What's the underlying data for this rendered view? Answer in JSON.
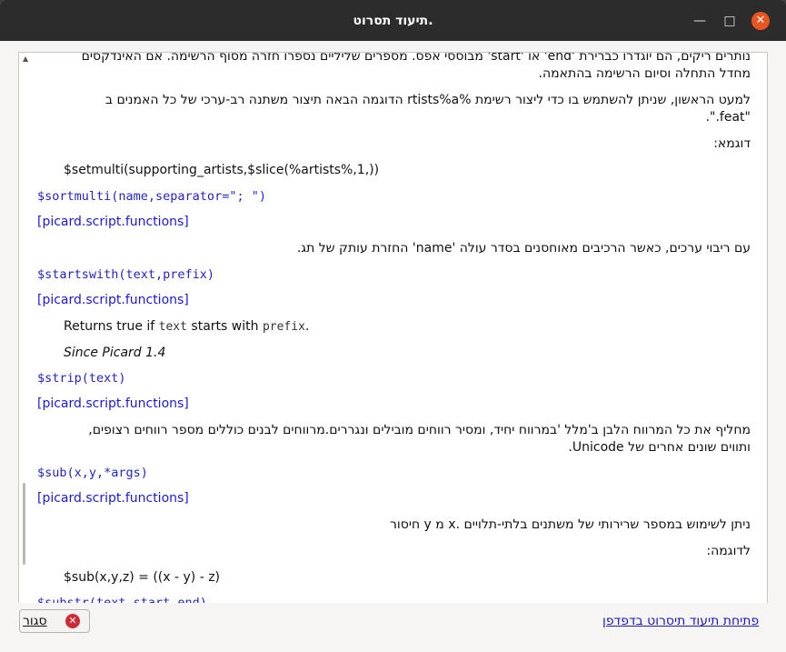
{
  "window": {
    "title": "תיעוד תסרוט.",
    "minimize_glyph": "—",
    "maximize_glyph": "□",
    "close_glyph": "✕"
  },
  "doc": {
    "lines": [
      "נותרים ריקים, הם יוגדרו כברירת 'end' או 'start' מבוססי אפס. מספרים שליליים נספרו חזרה מסוף הרשימה. אם האינדקסים",
      "מחדל התחלה וסיום הרשימה בהתאמה.",
      "למעט הראשון, שניתן להשתמש בו כדי ליצור רשימת %rtists%a הדוגמה הבאה תיצור משתנה רב-ערכי של כל האמנים ב",
      "\"feat.\".",
      "דוגמא:",
      "$setmulti(supporting_artists,$slice(%artists%,1,))",
      "$sortmulti(name,separator=\"; \")",
      "[picard.script.functions]",
      "עם ריבוי ערכים, כאשר הרכיבים מאוחסנים בסדר עולה 'name' החזרת עותק של תג.",
      "$startswith(text,prefix)",
      "[picard.script.functions]",
      "Returns true if",
      "text",
      "starts with",
      "prefix",
      ".",
      "Since Picard 1.4",
      "$strip(text)",
      "[picard.script.functions]",
      "מחליף את כל המרווח הלבן ב'מלל 'במרווח יחיד, ומסיר רווחים מובילים ונגררים.מרווחים לבנים כוללים מספר רווחים רצופים,",
      "ותווים שונים אחרים של Unicode.",
      "$sub(x,y,*args)",
      "[picard.script.functions]",
      "ניתן לשימוש במספר שרירותי של משתנים בלתי-תלויים .x מ y חיסור",
      "לדוגמה:",
      "$sub(x,y,z) = ((x - y) - z)",
      "$substr(text,start,end)"
    ]
  },
  "footer": {
    "close_label": "סגור",
    "close_icon_glyph": "✕",
    "open_in_browser": "פתיחת תיעוד תיסרוט בדפדפן"
  }
}
